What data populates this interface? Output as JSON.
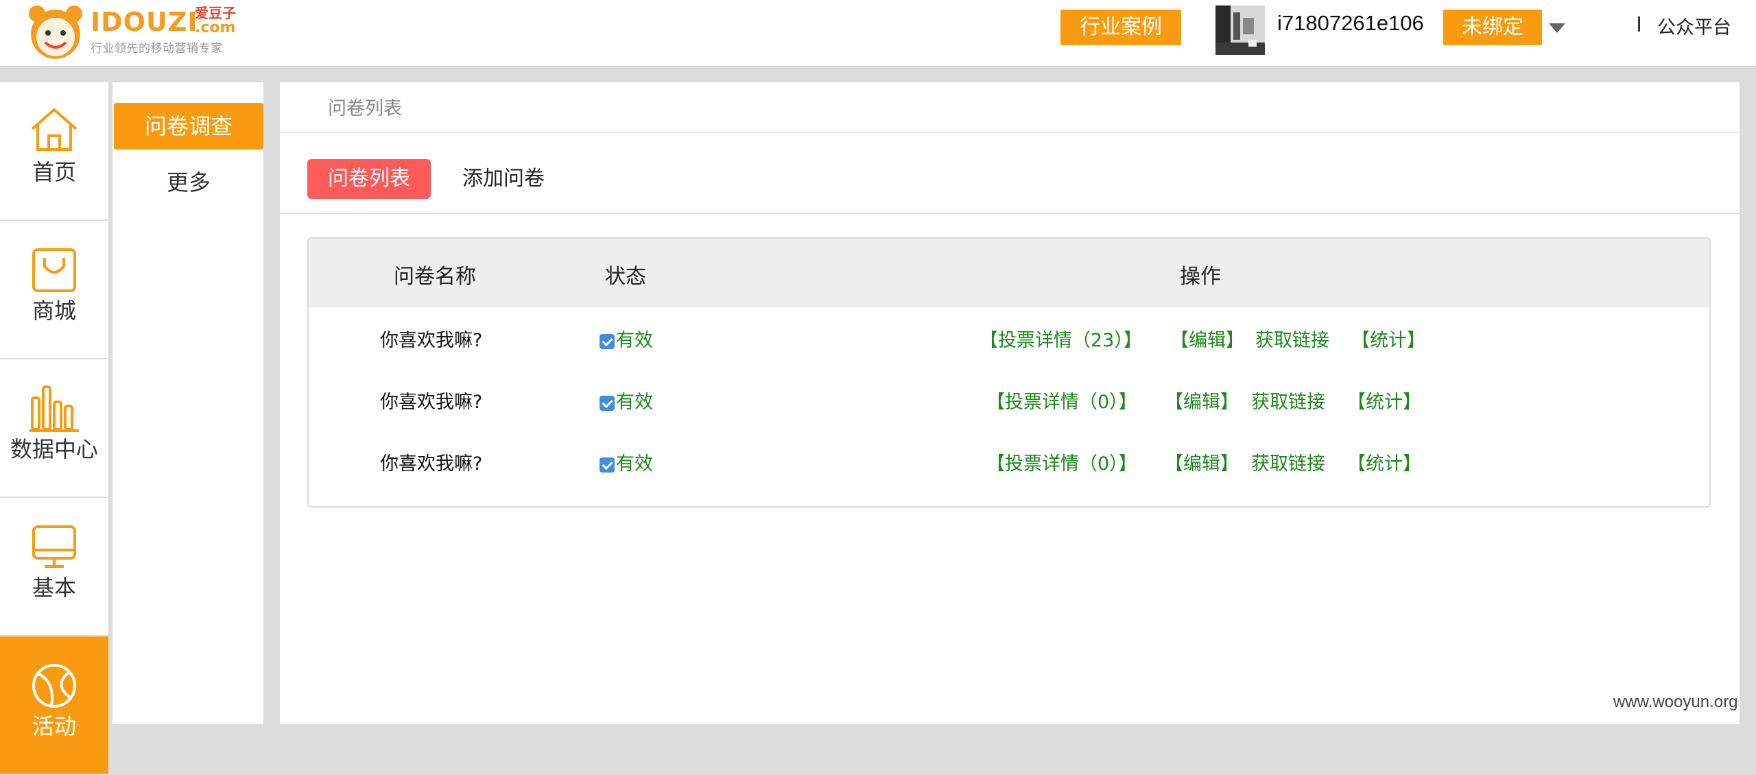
{
  "header": {
    "logo": {
      "wordmark": "IDOUZI",
      "cn_name": "爱豆子",
      "domain": ".com",
      "tagline": "行业领先的移动营销专家"
    },
    "cases_button": "行业案例",
    "username": "i71807261e106",
    "unbound_button": "未绑定",
    "separator": "I",
    "platform_link": "公众平台"
  },
  "sidebar": {
    "items": [
      {
        "label": "首页",
        "icon": "home-icon"
      },
      {
        "label": "商城",
        "icon": "shopping-bag-icon"
      },
      {
        "label": "数据中心",
        "icon": "bar-chart-icon"
      },
      {
        "label": "基本",
        "icon": "monitor-icon"
      },
      {
        "label": "活动",
        "icon": "ball-icon",
        "active": true
      }
    ]
  },
  "submenu": {
    "items": [
      {
        "label": "问卷调查",
        "active": true
      },
      {
        "label": "更多"
      }
    ]
  },
  "main": {
    "breadcrumb": "问卷列表",
    "tabs": [
      {
        "label": "问卷列表",
        "active": true
      },
      {
        "label": "添加问卷"
      }
    ],
    "table": {
      "headers": [
        "问卷名称",
        "状态",
        "操作"
      ],
      "rows": [
        {
          "name": "你喜欢我嘛?",
          "status": "有效",
          "ops": [
            "【投票详情（23）】",
            "【编辑】",
            "获取链接",
            "【统计】"
          ]
        },
        {
          "name": "你喜欢我嘛?",
          "status": "有效",
          "ops": [
            "【投票详情（0）】",
            "【编辑】",
            "获取链接",
            "【统计】"
          ]
        },
        {
          "name": "你喜欢我嘛?",
          "status": "有效",
          "ops": [
            "【投票详情（0）】",
            "【编辑】",
            "获取链接",
            "【统计】"
          ]
        }
      ]
    }
  },
  "watermark": "www.wooyun.org",
  "colors": {
    "accent_orange": "#f99b10",
    "tab_active_red": "#ff5a5a",
    "status_green": "#1a8a1a",
    "checkbox_blue": "#3f8ddb"
  }
}
